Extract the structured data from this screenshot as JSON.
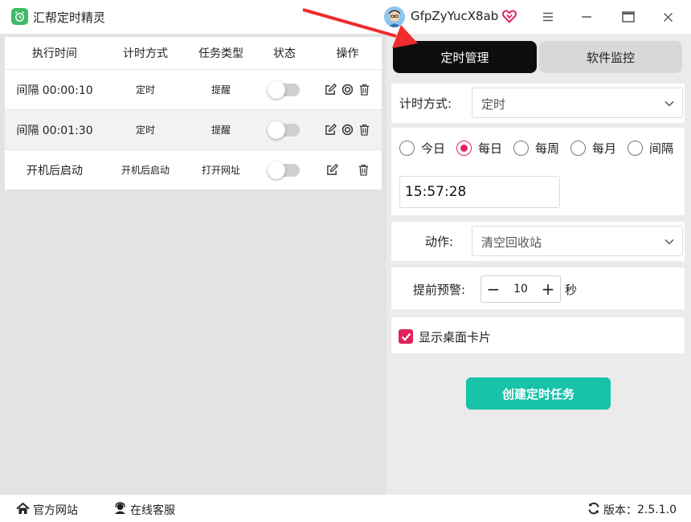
{
  "app": {
    "title": "汇帮定时精灵",
    "username": "GfpZyYucX8ab",
    "icons": {
      "logo": "alarm-clock-icon",
      "avatar": "user-avatar",
      "vip": "vip-heart-icon",
      "menu": "hamburger-icon",
      "maximize": "maximize-icon",
      "close": "close-icon"
    }
  },
  "task_table": {
    "headers": [
      "执行时间",
      "计时方式",
      "任务类型",
      "状态",
      "操作"
    ],
    "rows": [
      {
        "time": "间隔 00:00:10",
        "mode": "定时",
        "type": "提醒",
        "enabled": false,
        "actions": [
          "edit-icon",
          "target-icon",
          "trash-icon"
        ]
      },
      {
        "time": "间隔 00:01:30",
        "mode": "定时",
        "type": "提醒",
        "enabled": false,
        "actions": [
          "edit-icon",
          "target-icon",
          "trash-icon"
        ]
      },
      {
        "time": "开机后启动",
        "mode": "开机后启动",
        "type": "打开网址",
        "enabled": false,
        "actions": [
          "edit-icon",
          "trash-icon"
        ]
      }
    ]
  },
  "tabs": {
    "active": "定时管理",
    "inactive": "软件监控"
  },
  "form": {
    "timing_label": "计时方式:",
    "timing_value": "定时",
    "frequency_options": [
      "今日",
      "每日",
      "每周",
      "每月",
      "间隔"
    ],
    "frequency_selected": "每日",
    "time_value": "15:57:28",
    "action_label": "动作:",
    "action_value": "清空回收站",
    "warn_label": "提前预警:",
    "warn_value": "10",
    "warn_unit": "秒",
    "stepper_minus": "−",
    "stepper_plus": "+",
    "show_card_label": "显示桌面卡片",
    "show_card_checked": true,
    "create_button": "创建定时任务"
  },
  "footer": {
    "website": "官方网站",
    "support": "在线客服",
    "version_label": "版本：",
    "version": "2.5.1.0"
  },
  "colors": {
    "accent_red": "#e0245e",
    "create_button": "#17c3a9",
    "active_tab": "#0d0d0d",
    "logo_green": "#3dbb66",
    "annotation_arrow": "#ee2c2c"
  }
}
